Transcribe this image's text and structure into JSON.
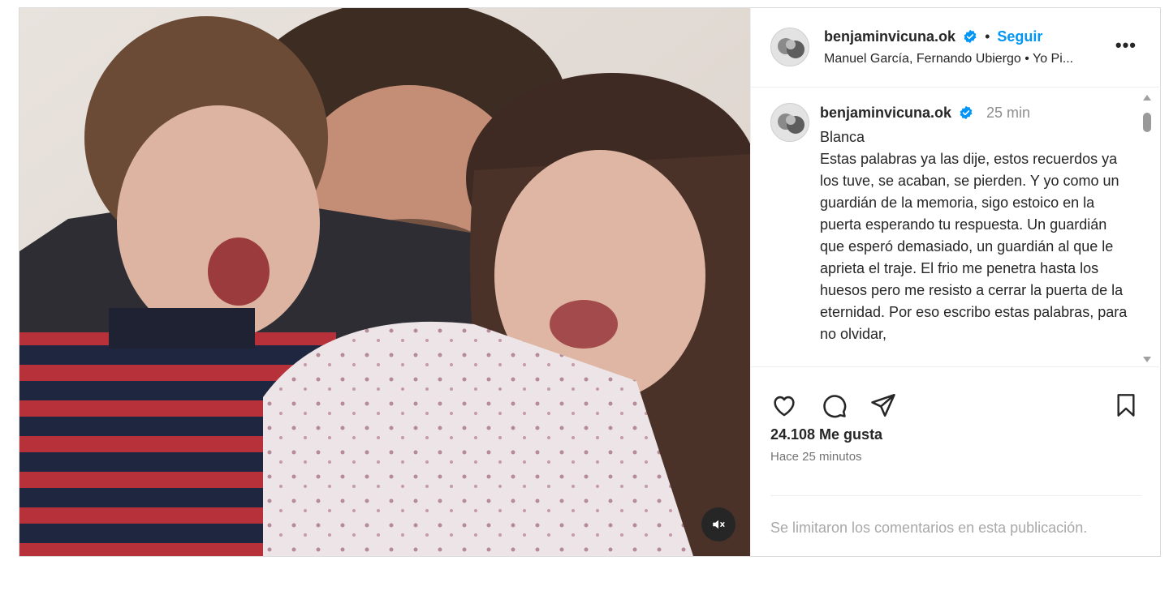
{
  "post": {
    "header": {
      "username": "benjaminvicuna.ok",
      "separator": "•",
      "follow_label": "Seguir",
      "subtitle": "Manuel García, Fernando Ubiergo • Yo Pi...",
      "more_label": "•••"
    },
    "caption": {
      "username": "benjaminvicuna.ok",
      "time": "25 min",
      "title": "Blanca",
      "text": "Estas palabras ya las dije, estos recuerdos ya los tuve, se acaban, se pierden. Y yo como un guardián de la memoria, sigo estoico en la puerta esperando tu respuesta. Un guardián que esperó demasiado, un guardián al que le aprieta el traje. El frio me penetra hasta los huesos pero me resisto a cerrar la puerta de la eternidad. Por eso escribo estas palabras, para no olvidar,"
    },
    "actions": {
      "likes": "24.108 Me gusta",
      "ago": "Hace 25 minutos",
      "comments_limited": "Se limitaron los comentarios en esta publicación."
    },
    "icons": {
      "like": "heart-icon",
      "comment": "comment-icon",
      "share": "send-icon",
      "save": "bookmark-icon",
      "mute": "speaker-muted-icon",
      "verified": "verified-badge-icon"
    },
    "colors": {
      "accent": "#0095f6",
      "muted_text": "#737373",
      "limited_text": "#a8a8a8",
      "border": "#dbdbdb"
    }
  }
}
